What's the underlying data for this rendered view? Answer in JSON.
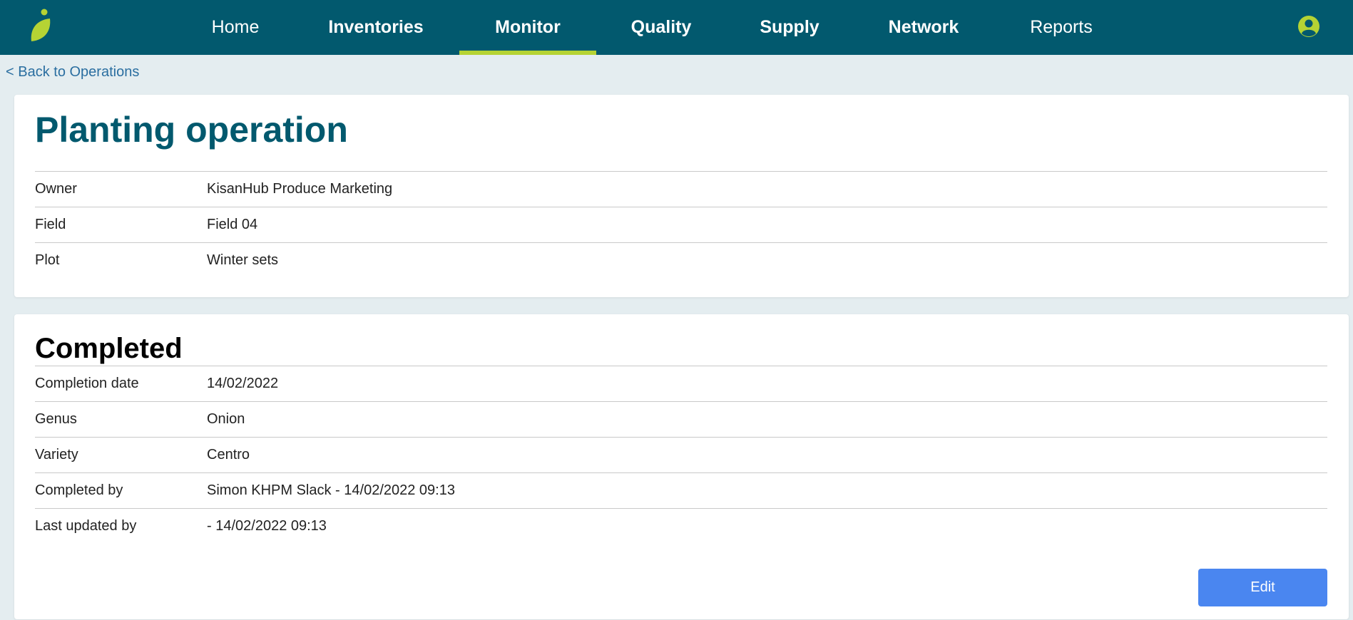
{
  "nav": {
    "items": [
      {
        "label": "Home"
      },
      {
        "label": "Inventories"
      },
      {
        "label": "Monitor"
      },
      {
        "label": "Quality"
      },
      {
        "label": "Supply"
      },
      {
        "label": "Network"
      },
      {
        "label": "Reports"
      }
    ],
    "active": "Monitor"
  },
  "colors": {
    "topbar": "#02596e",
    "accent": "#b5d334",
    "title": "#02596e",
    "button": "#4a86f0"
  },
  "icons": {
    "logo": "leaf-logo-icon",
    "user": "user-account-icon"
  },
  "back_link": "< Back to Operations",
  "operation": {
    "title": "Planting operation",
    "rows": [
      {
        "label": "Owner",
        "value": "KisanHub Produce Marketing"
      },
      {
        "label": "Field",
        "value": "Field 04"
      },
      {
        "label": "Plot",
        "value": "Winter sets"
      }
    ]
  },
  "completion": {
    "title": "Completed",
    "rows": [
      {
        "label": "Completion date",
        "value": "14/02/2022"
      },
      {
        "label": "Genus",
        "value": "Onion"
      },
      {
        "label": "Variety",
        "value": "Centro"
      },
      {
        "label": "Completed by",
        "value": "Simon KHPM Slack - 14/02/2022 09:13"
      },
      {
        "label": "Last updated by",
        "value": "- 14/02/2022 09:13"
      }
    ],
    "edit_label": "Edit"
  }
}
